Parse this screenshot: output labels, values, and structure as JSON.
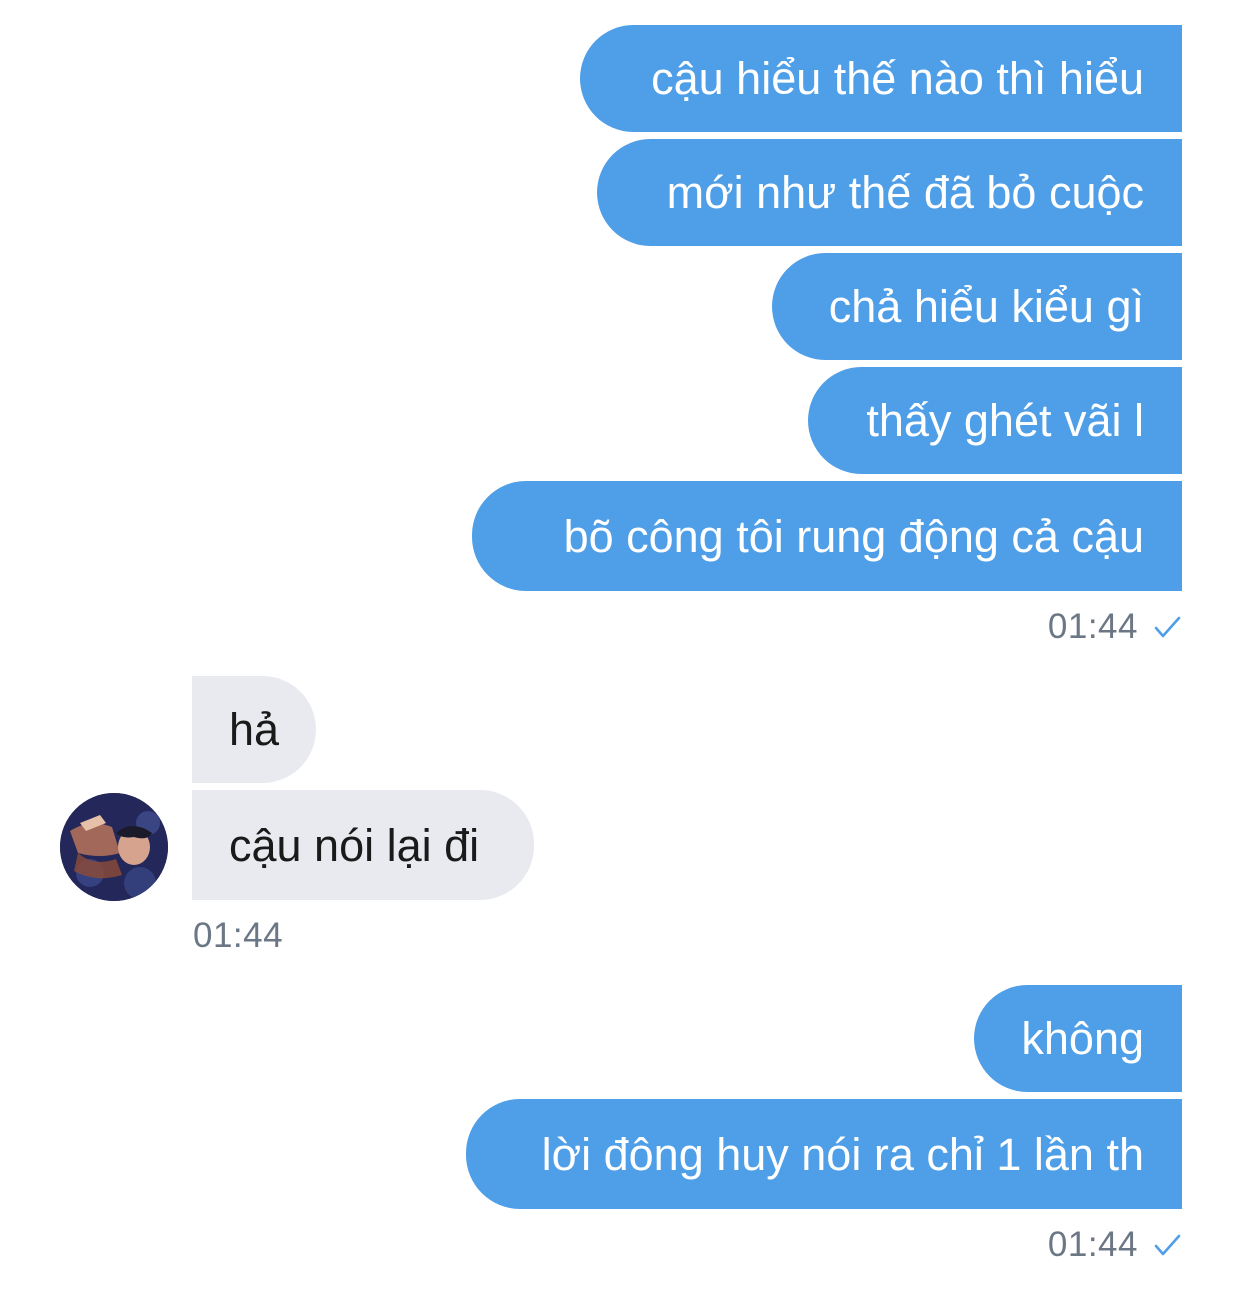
{
  "messages_group_1": {
    "bubbles": [
      "cậu hiểu thế nào thì hiểu",
      "mới như thế đã bỏ cuộc",
      "chả hiểu kiểu gì",
      "thấy ghét vãi l",
      "bõ công tôi rung động cả cậu"
    ],
    "time": "01:44",
    "status_icon": "checkmark-icon"
  },
  "messages_group_2": {
    "bubbles": [
      "hả",
      "cậu nói lại đi"
    ],
    "time": "01:44",
    "avatar": "contact-avatar"
  },
  "messages_group_3": {
    "bubbles": [
      "không",
      "lời đông huy nói ra chỉ 1 lần th"
    ],
    "time": "01:44",
    "status_icon": "checkmark-icon"
  },
  "colors": {
    "outgoing_bubble": "#4f9ee8",
    "incoming_bubble": "#e8eaf0",
    "timestamp": "#6b7785",
    "check": "#4f9ee8"
  }
}
